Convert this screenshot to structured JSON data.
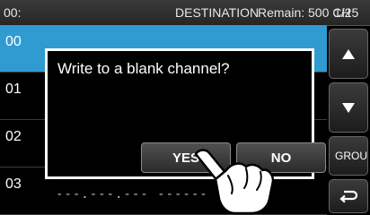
{
  "header": {
    "channel": "00:",
    "title": "DESTINATION",
    "remain": "Remain: 500 CH",
    "page": "1/25"
  },
  "list": {
    "rows": [
      {
        "number": "00",
        "value": "--- --- ---   ------",
        "selected": true
      },
      {
        "number": "01",
        "value": ""
      },
      {
        "number": "02",
        "value": ""
      },
      {
        "number": "03",
        "value": "---.---.---   ------"
      }
    ]
  },
  "side_buttons": {
    "up_icon": "triangle-up-icon",
    "down_icon": "triangle-down-icon",
    "group_label": "GROUP",
    "back_icon": "return-arrow-icon"
  },
  "dialog": {
    "message": "Write to a blank channel?",
    "yes_label": "YES",
    "no_label": "NO"
  },
  "colors": {
    "selected_row": "#2f9bd1",
    "background": "#000000",
    "text": "#ffffff"
  }
}
